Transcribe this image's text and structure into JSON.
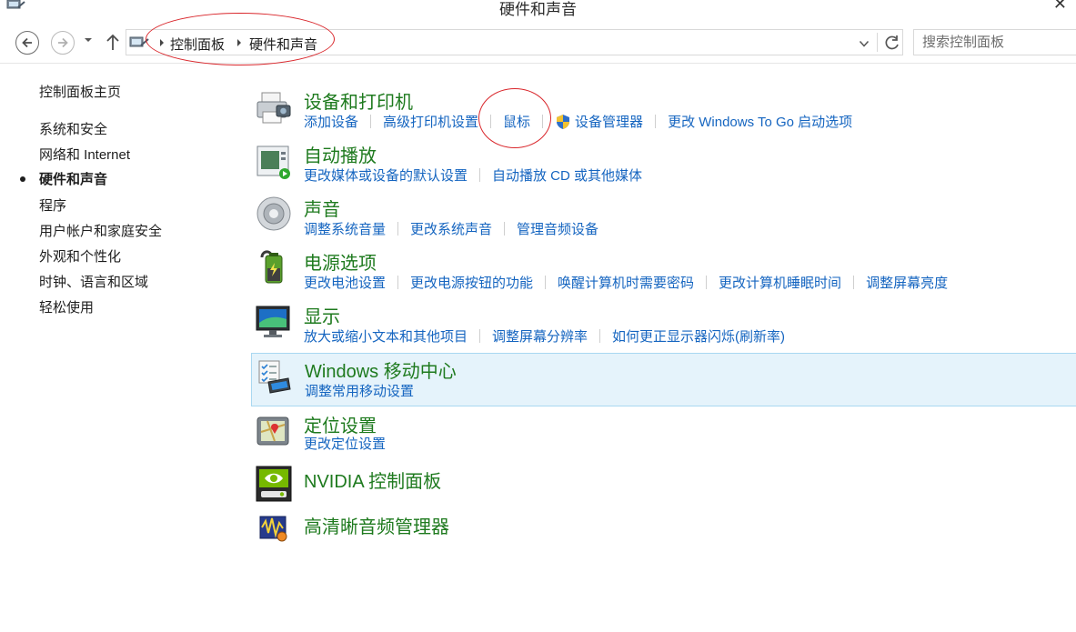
{
  "window": {
    "title": "硬件和声音"
  },
  "address_bar": {
    "crumbs": [
      "控制面板",
      "硬件和声音"
    ]
  },
  "search": {
    "placeholder": "搜索控制面板"
  },
  "left_nav": {
    "home": "控制面板主页",
    "items": [
      "系统和安全",
      "网络和 Internet",
      "硬件和声音",
      "程序",
      "用户帐户和家庭安全",
      "外观和个性化",
      "时钟、语言和区域",
      "轻松使用"
    ],
    "active_index": 2
  },
  "categories": [
    {
      "title": "设备和打印机",
      "icon": "printer-icon",
      "links": [
        "添加设备",
        "高级打印机设置",
        "鼠标",
        "设备管理器",
        "更改 Windows To Go 启动选项"
      ]
    },
    {
      "title": "自动播放",
      "icon": "autoplay-icon",
      "links": [
        "更改媒体或设备的默认设置",
        "自动播放 CD 或其他媒体"
      ]
    },
    {
      "title": "声音",
      "icon": "speaker-icon",
      "links": [
        "调整系统音量",
        "更改系统声音",
        "管理音频设备"
      ]
    },
    {
      "title": "电源选项",
      "icon": "battery-icon",
      "links": [
        "更改电池设置",
        "更改电源按钮的功能",
        "唤醒计算机时需要密码",
        "更改计算机睡眠时间",
        "调整屏幕亮度"
      ]
    },
    {
      "title": "显示",
      "icon": "monitor-icon",
      "links": [
        "放大或缩小文本和其他项目",
        "调整屏幕分辨率",
        "如何更正显示器闪烁(刷新率)"
      ]
    },
    {
      "title": "Windows 移动中心",
      "icon": "mobility-center-icon",
      "links": [
        "调整常用移动设置"
      ]
    },
    {
      "title": "定位设置",
      "icon": "location-icon",
      "links": [
        "更改定位设置"
      ]
    },
    {
      "title": "NVIDIA 控制面板",
      "icon": "nvidia-icon",
      "links": []
    },
    {
      "title": "高清晰音频管理器",
      "icon": "audio-manager-icon",
      "links": []
    }
  ],
  "colors": {
    "title_green": "#1e7a1e",
    "link_blue": "#1565c0",
    "highlight_bg": "#e5f3fb",
    "annotation_red": "#d9262b"
  }
}
